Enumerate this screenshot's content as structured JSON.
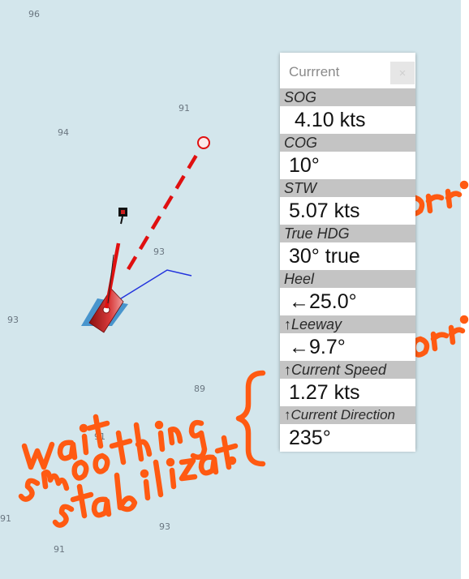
{
  "depth_soundings": [
    "96",
    "91",
    "94",
    "93",
    "93",
    "89",
    "91",
    "91",
    "93",
    "91"
  ],
  "panel": {
    "title": "Currrent",
    "close_symbol": "×",
    "fields": [
      {
        "label": "SOG",
        "value": "4.10 kts"
      },
      {
        "label": "COG",
        "value": "10°"
      },
      {
        "label": "STW",
        "value": "5.07 kts"
      },
      {
        "label": "True HDG",
        "value": "30° true"
      },
      {
        "label": "Heel",
        "value": "←25.0°"
      },
      {
        "label": "↑Leeway",
        "value": "←9.7°"
      },
      {
        "label": "↑Current Speed",
        "value": "1.27 kts"
      },
      {
        "label": "↑Current Direction",
        "value": "235°"
      }
    ]
  },
  "annotations": {
    "color": "#ff5a12",
    "notes": [
      "corr.",
      "corr.",
      "wait",
      "smoothing",
      "stabilizat."
    ]
  },
  "colors": {
    "water": "#d3e6ec",
    "vessel": "#c01818",
    "course_line": "#e01010",
    "track_line": "#2233dd",
    "leeway_wedge": "#2f86c8"
  }
}
